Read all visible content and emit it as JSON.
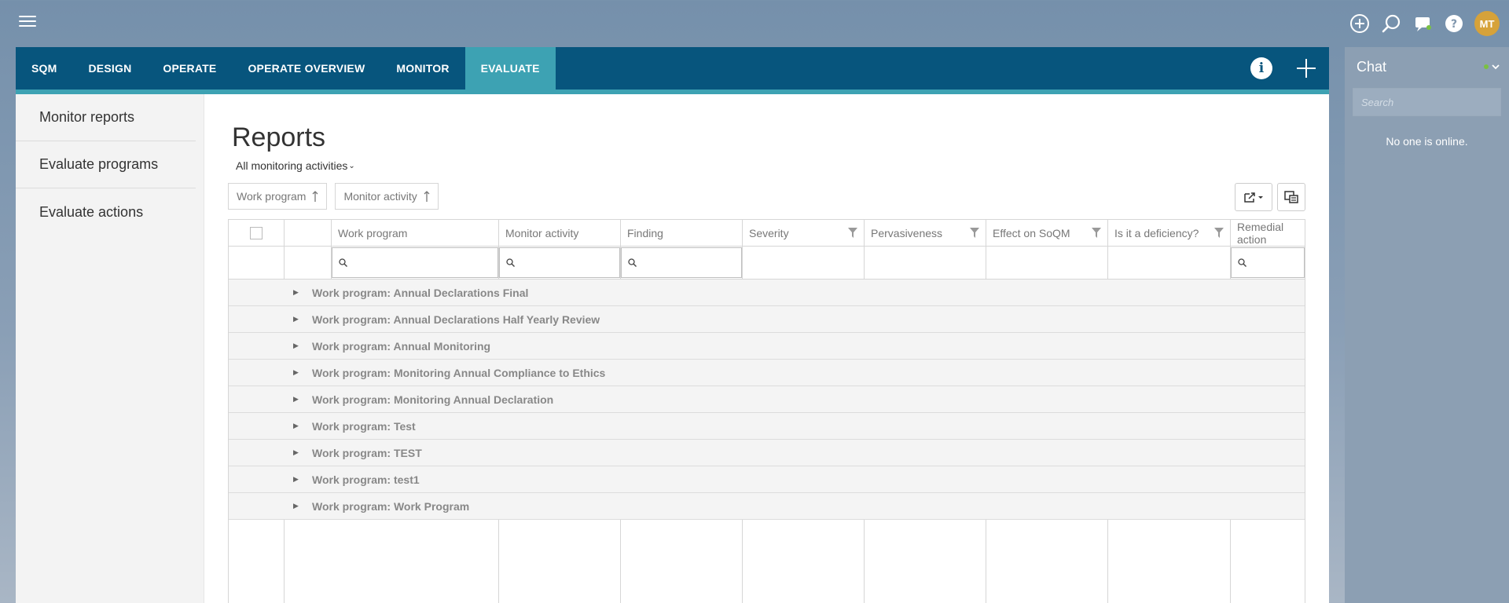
{
  "topbar": {
    "user_initials": "MT",
    "icons": [
      "plus-circle-icon",
      "search-icon",
      "chat-bubble-icon",
      "help-icon"
    ]
  },
  "nav": {
    "tabs": [
      {
        "label": "SQM",
        "active": false
      },
      {
        "label": "DESIGN",
        "active": false
      },
      {
        "label": "OPERATE",
        "active": false
      },
      {
        "label": "OPERATE OVERVIEW",
        "active": false
      },
      {
        "label": "MONITOR",
        "active": false
      },
      {
        "label": "EVALUATE",
        "active": true
      }
    ],
    "info_glyph": "i"
  },
  "sidebar": {
    "items": [
      {
        "label": "Monitor reports"
      },
      {
        "label": "Evaluate programs"
      },
      {
        "label": "Evaluate actions"
      }
    ]
  },
  "main": {
    "title": "Reports",
    "filter_label": "All monitoring activities",
    "group_by": [
      "Work program",
      "Monitor activity"
    ],
    "columns": [
      "Work program",
      "Monitor activity",
      "Finding",
      "Severity",
      "Pervasiveness",
      "Effect on SoQM",
      "Is it a deficiency?",
      "Remedial action"
    ],
    "groups": [
      "Work program: Annual Declarations Final",
      "Work program: Annual Declarations Half Yearly Review",
      "Work program: Annual Monitoring",
      "Work program: Monitoring Annual Compliance to Ethics",
      "Work program: Monitoring Annual Declaration",
      "Work program: Test",
      "Work program: TEST",
      "Work program: test1",
      "Work program: Work Program"
    ]
  },
  "chat": {
    "title": "Chat",
    "search_placeholder": "Search",
    "empty_message": "No one is online.",
    "status_color": "#7ac142"
  },
  "colors": {
    "nav_bg": "#07557d",
    "accent": "#3da2b3",
    "avatar": "#d6a23a"
  }
}
